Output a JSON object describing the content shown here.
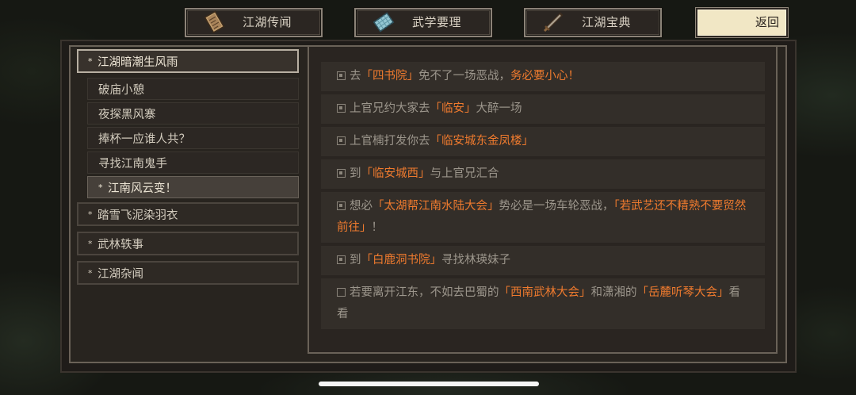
{
  "tabs": [
    {
      "label": "江湖传闻",
      "icon": "scroll-map-icon"
    },
    {
      "label": "武学要理",
      "icon": "manual-book-icon"
    },
    {
      "label": "江湖宝典",
      "icon": "sword-icon"
    }
  ],
  "back_button": {
    "label": "返回"
  },
  "quest_list": {
    "groups": [
      {
        "marker": "*",
        "label": "江湖暗潮生风雨",
        "expanded": true,
        "selected": true,
        "quests": [
          {
            "label": "破庙小憩"
          },
          {
            "label": "夜探黑风寨"
          },
          {
            "label": "捧杯一应谁人共？"
          },
          {
            "label": "寻找江南鬼手"
          },
          {
            "marker": "*",
            "label": "江南风云变！",
            "selected": true
          }
        ]
      },
      {
        "marker": "*",
        "label": "踏雪飞泥染羽衣",
        "expanded": false
      },
      {
        "marker": "*",
        "label": "武林轶事",
        "expanded": false
      },
      {
        "marker": "*",
        "label": "江湖杂闻",
        "expanded": false
      }
    ]
  },
  "objectives": [
    {
      "icon": "checked-box-icon",
      "segments": [
        {
          "text": "去"
        },
        {
          "text": "「四书院」",
          "highlight": true
        },
        {
          "text": "免不了一场恶战，"
        },
        {
          "text": "务必要小心！",
          "highlight": true
        }
      ]
    },
    {
      "icon": "checked-box-icon",
      "segments": [
        {
          "text": "上官兄约大家去"
        },
        {
          "text": "「临安」",
          "highlight": true
        },
        {
          "text": "大醉一场"
        }
      ]
    },
    {
      "icon": "checked-box-icon",
      "segments": [
        {
          "text": "上官楠打发你去"
        },
        {
          "text": "「临安城东金凤楼」",
          "highlight": true
        }
      ]
    },
    {
      "icon": "checked-box-icon",
      "segments": [
        {
          "text": "到"
        },
        {
          "text": "「临安城西」",
          "highlight": true
        },
        {
          "text": "与上官兄汇合"
        }
      ]
    },
    {
      "icon": "checked-box-icon",
      "segments": [
        {
          "text": "想必"
        },
        {
          "text": "「太湖帮江南水陆大会」",
          "highlight": true
        },
        {
          "text": "势必是一场车轮恶战，"
        },
        {
          "text": "「若武艺还不精熟不要贸然前往」",
          "highlight": true
        },
        {
          "text": "！"
        }
      ]
    },
    {
      "icon": "checked-box-icon",
      "segments": [
        {
          "text": "到"
        },
        {
          "text": "「白鹿洞书院」",
          "highlight": true
        },
        {
          "text": "寻找林瑛妹子"
        }
      ]
    },
    {
      "icon": "unchecked-box-icon",
      "segments": [
        {
          "text": "若要离开江东，不如去巴蜀的"
        },
        {
          "text": "「西南武林大会」",
          "highlight": true
        },
        {
          "text": "和潇湘的"
        },
        {
          "text": "「岳麓听琴大会」",
          "highlight": true
        },
        {
          "text": "看看"
        }
      ]
    }
  ],
  "theme": {
    "highlight": "#ee7a2e",
    "body-text": "#9c968c",
    "list-text": "#d3ccbe",
    "tab-text": "#dad2c4",
    "back-bg": "#f1e7c5"
  }
}
